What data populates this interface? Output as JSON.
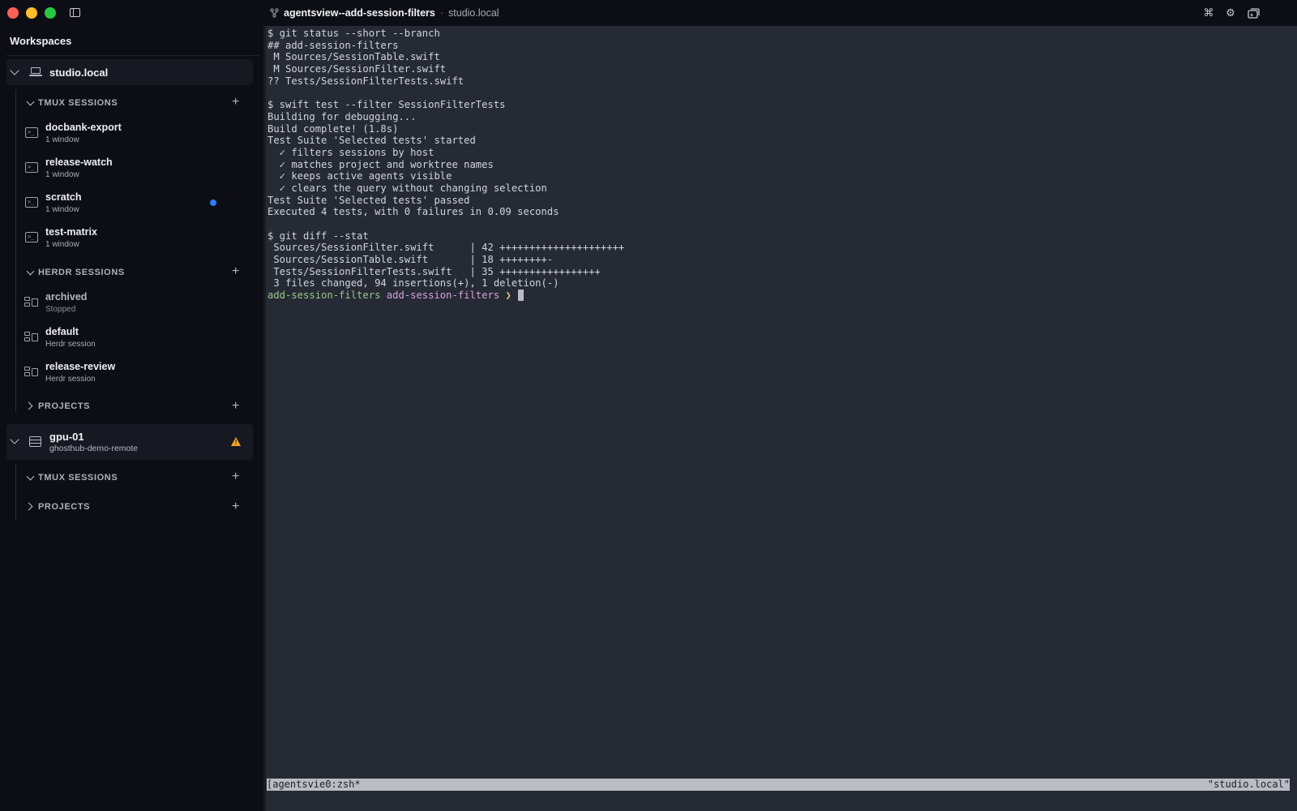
{
  "window": {
    "title": "agentsview--add-session-filters",
    "separator": "·",
    "host": "studio.local"
  },
  "sidebar": {
    "header": "Workspaces",
    "workspaces": [
      {
        "name": "studio.local",
        "sections": {
          "tmux": {
            "label": "TMUX SESSIONS",
            "items": [
              {
                "name": "docbank-export",
                "sub": "1 window"
              },
              {
                "name": "release-watch",
                "sub": "1 window"
              },
              {
                "name": "scratch",
                "sub": "1 window"
              },
              {
                "name": "test-matrix",
                "sub": "1 window"
              }
            ]
          },
          "herdr": {
            "label": "HERDR SESSIONS",
            "items": [
              {
                "name": "archived",
                "sub": "Stopped"
              },
              {
                "name": "default",
                "sub": "Herdr session"
              },
              {
                "name": "release-review",
                "sub": "Herdr session"
              }
            ]
          },
          "projects": {
            "label": "PROJECTS"
          }
        }
      },
      {
        "name": "gpu-01",
        "sub": "ghosthub-demo-remote",
        "sections": {
          "tmux": {
            "label": "TMUX SESSIONS"
          },
          "projects": {
            "label": "PROJECTS"
          }
        }
      }
    ]
  },
  "terminal": {
    "lines": [
      "$ git status --short --branch",
      "## add-session-filters",
      " M Sources/SessionTable.swift",
      " M Sources/SessionFilter.swift",
      "?? Tests/SessionFilterTests.swift",
      "",
      "$ swift test --filter SessionFilterTests",
      "Building for debugging...",
      "Build complete! (1.8s)",
      "Test Suite 'Selected tests' started",
      "  ✓ filters sessions by host",
      "  ✓ matches project and worktree names",
      "  ✓ keeps active agents visible",
      "  ✓ clears the query without changing selection",
      "Test Suite 'Selected tests' passed",
      "Executed 4 tests, with 0 failures in 0.09 seconds",
      "",
      "$ git diff --stat",
      " Sources/SessionFilter.swift      | 42 +++++++++++++++++++++",
      " Sources/SessionTable.swift       | 18 ++++++++-",
      " Tests/SessionFilterTests.swift   | 35 +++++++++++++++++",
      " 3 files changed, 94 insertions(+), 1 deletion(-)"
    ],
    "prompt": {
      "dir": "add-session-filters",
      "branch": "add-session-filters",
      "symbol": "❯"
    },
    "status_left": "[agentsvie0:zsh*",
    "status_right": "\"studio.local\""
  },
  "icons": {
    "branch": "branch-icon",
    "command": "⌘",
    "settings": "⚙"
  },
  "colors": {
    "notification_dot": "#2a7df5",
    "warning": "#f5a524"
  }
}
